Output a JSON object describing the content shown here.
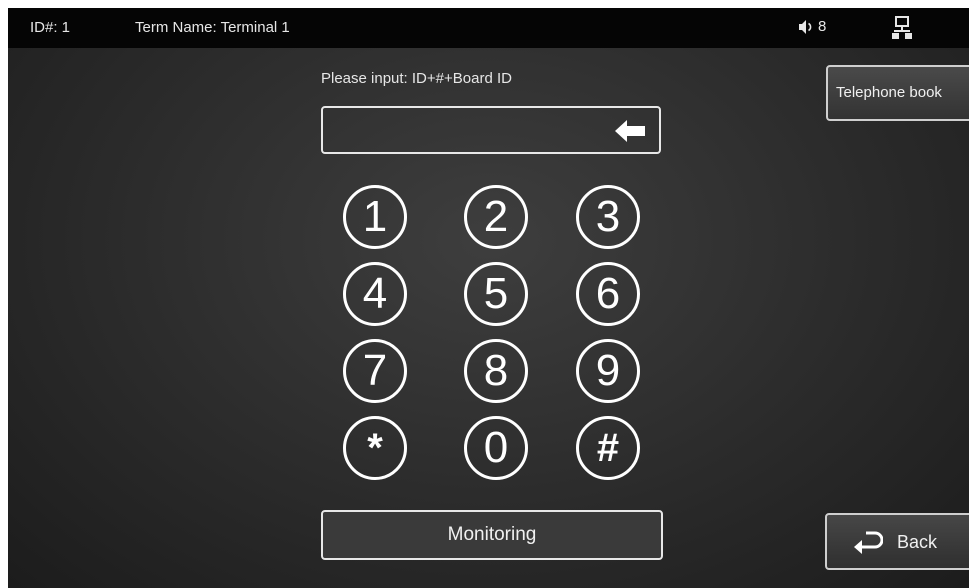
{
  "status_bar": {
    "id_text": "ID#: 1",
    "term_text": "Term Name: Terminal 1",
    "volume": "8",
    "volume_icon": "speaker-icon",
    "network_icon": "network-icon"
  },
  "call": {
    "prompt": "Please input: ID+#+Board ID",
    "input_value": "",
    "backspace_icon": "backspace-arrow-icon"
  },
  "keypad": {
    "keys": [
      "1",
      "2",
      "3",
      "4",
      "5",
      "6",
      "7",
      "8",
      "9",
      "*",
      "0",
      "#"
    ]
  },
  "buttons": {
    "monitoring": "Monitoring",
    "telephone_book": "Telephone book",
    "back": "Back",
    "back_icon": "return-arrow-icon"
  },
  "colors": {
    "top_bar": "#050505",
    "background": "#2e2e2e",
    "foreground": "#ffffff"
  }
}
